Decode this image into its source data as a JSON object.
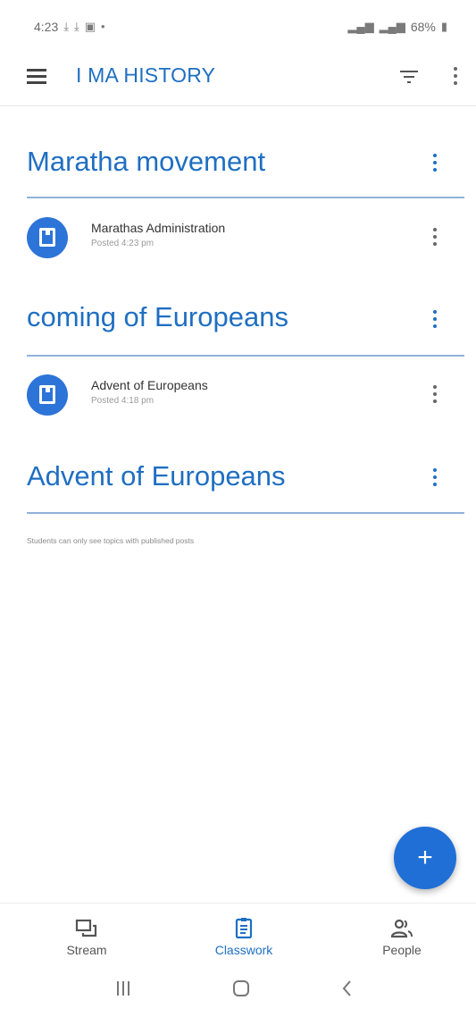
{
  "status_bar": {
    "time": "4:23",
    "battery": "68%"
  },
  "app_bar": {
    "title": "I MA HISTORY"
  },
  "topics": [
    {
      "title": "Maratha movement",
      "items": [
        {
          "title": "Marathas Administration",
          "posted": "Posted 4:23 pm"
        }
      ]
    },
    {
      "title": "coming of Europeans",
      "items": [
        {
          "title": "Advent of Europeans",
          "posted": "Posted 4:18 pm"
        }
      ]
    },
    {
      "title": "Advent of Europeans",
      "items": []
    }
  ],
  "footer_note": "Students can only see topics with published posts",
  "fab": {
    "symbol": "+"
  },
  "bottom_nav": {
    "items": [
      {
        "label": "Stream",
        "icon": "stream-icon"
      },
      {
        "label": "Classwork",
        "icon": "classwork-icon"
      },
      {
        "label": "People",
        "icon": "people-icon"
      }
    ],
    "active": "Classwork"
  },
  "colors": {
    "accent": "#1f6fc2",
    "fab": "#1f6fd6",
    "divider": "#8fb3d9"
  }
}
